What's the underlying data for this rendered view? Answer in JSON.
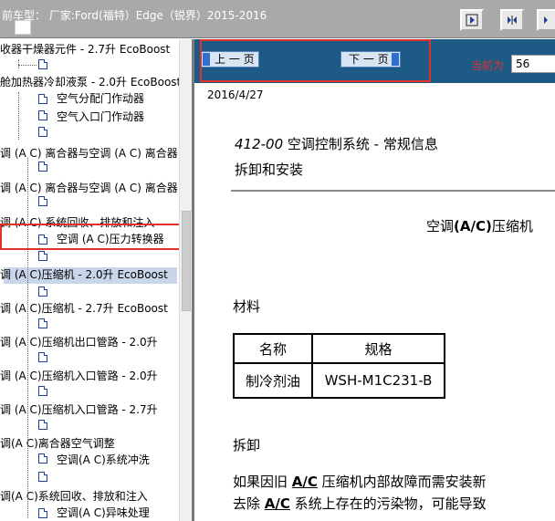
{
  "topbar": {
    "vehicle_title": "前车型： 厂家:Ford(福特）Edge（锐界）2015-2016",
    "buttons": [
      "first-page-icon",
      "expand-icon",
      "collapse-icon"
    ]
  },
  "tree": {
    "items": [
      {
        "label": "收器干燥器元件 - 2.7升 EcoBoost"
      },
      {
        "label": "舱加热器冷却液泵 - 2.0升 EcoBoost"
      },
      {
        "label": "空气分配门作动器"
      },
      {
        "label": "空气入口门作动器"
      },
      {
        "label": "调 (A C) 离合器与空调 (A C) 离合器"
      },
      {
        "label": "调 (A C) 离合器与空调 (A C) 离合器"
      },
      {
        "label": "调 (A C) 系统回收、排放和注入"
      },
      {
        "label": "空调 (A C)压力转换器"
      },
      {
        "label": "调 (A C)压缩机 - 2.0升 EcoBoost"
      },
      {
        "label": "调 (A C)压缩机 - 2.7升 EcoBoost"
      },
      {
        "label": "调 (A C)压缩机出口管路 - 2.0升"
      },
      {
        "label": "调 (A C)压缩机入口管路 - 2.0升"
      },
      {
        "label": "调 (A C)压缩机入口管路 - 2.7升"
      },
      {
        "label": "调(A C)离合器空气调整"
      },
      {
        "label": "空调(A C)系统冲洗"
      },
      {
        "label": "调(A C)系统回收、排放和注入"
      },
      {
        "label": "空调(A C)异味处理"
      }
    ]
  },
  "nav": {
    "prev_label": "上 一 页",
    "next_label": "下 一 页",
    "current_label": "当前为",
    "page_value": "56"
  },
  "doc": {
    "date": "2016/4/27",
    "section_code": "412-00",
    "section_title": " 空调控制系统 - 常规信息",
    "subtitle": "拆卸和安装",
    "heading_pre": "空调",
    "heading_bold": "(A/C)",
    "heading_post": "压缩机",
    "materials_label": "材料",
    "table": {
      "headers": [
        "名称",
        "规格"
      ],
      "rows": [
        [
          "制冷剂油",
          "WSH-M1C231-B"
        ]
      ]
    },
    "removal_label": "拆卸",
    "para1_pre": "如果因旧 ",
    "para1_bold": "A/C",
    "para1_post": " 压缩机内部故障而需安装新",
    "para2_pre": "去除 ",
    "para2_bold": "A/C",
    "para2_post": " 系统上存在的污染物，可能导致"
  },
  "colors": {
    "topbar": "#a9a9a9",
    "navbar": "#1d5a86",
    "highlight": "#e0312a",
    "selected_row": "#c9d6ea"
  }
}
